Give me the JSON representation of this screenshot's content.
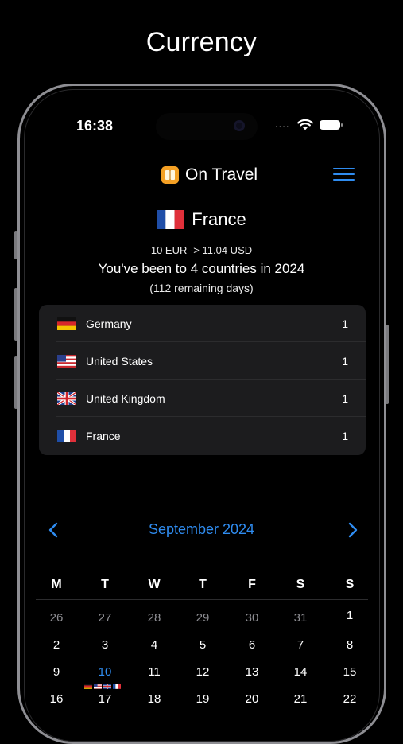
{
  "promo": {
    "title": "Currency"
  },
  "status_bar": {
    "time": "16:38",
    "signal": "....",
    "signal_icon": "signal-dots-icon",
    "wifi_icon": "wifi-icon",
    "battery_icon": "battery-icon"
  },
  "header": {
    "app_title": "On Travel",
    "logo_icon": "book-icon",
    "menu_icon": "hamburger-menu-icon"
  },
  "current": {
    "country": "France",
    "flag_icon": "flag-france-icon",
    "currency": "10 EUR -> 11.04 USD",
    "summary": "You've been to 4 countries in 2024",
    "remaining": "(112 remaining days)"
  },
  "countries": [
    {
      "name": "Germany",
      "count": "1",
      "flag": "de"
    },
    {
      "name": "United States",
      "count": "1",
      "flag": "us"
    },
    {
      "name": "United Kingdom",
      "count": "1",
      "flag": "gb"
    },
    {
      "name": "France",
      "count": "1",
      "flag": "fr"
    }
  ],
  "calendar": {
    "month_label": "September 2024",
    "prev_icon": "chevron-left-icon",
    "next_icon": "chevron-right-icon",
    "weekdays": [
      "M",
      "T",
      "W",
      "T",
      "F",
      "S",
      "S"
    ],
    "weeks": [
      [
        "26",
        "27",
        "28",
        "29",
        "30",
        "31",
        "1"
      ],
      [
        "2",
        "3",
        "4",
        "5",
        "6",
        "7",
        "8"
      ],
      [
        "9",
        "10",
        "11",
        "12",
        "13",
        "14",
        "15"
      ],
      [
        "16",
        "17",
        "18",
        "19",
        "20",
        "21",
        "22"
      ]
    ],
    "outside_days": [
      "26",
      "27",
      "28",
      "29",
      "30",
      "31"
    ],
    "today": "10",
    "today_flags": [
      "de",
      "us",
      "gb",
      "fr"
    ]
  },
  "colors": {
    "accent": "#2f8cf0",
    "card": "#1c1c1e",
    "logo": "#f4a024",
    "muted": "#8e8e93"
  }
}
